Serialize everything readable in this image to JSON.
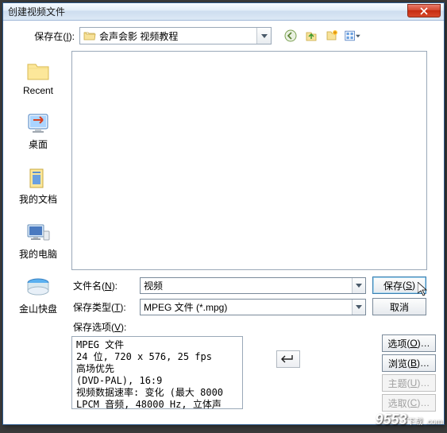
{
  "title": "创建视频文件",
  "save_in_label": "保存在",
  "save_in_key": "I",
  "location": "会声会影  视频教程",
  "sidebar": [
    {
      "label": "Recent"
    },
    {
      "label": "桌面"
    },
    {
      "label": "我的文档"
    },
    {
      "label": "我的电脑"
    },
    {
      "label": "金山快盘"
    }
  ],
  "filename_label": "文件名",
  "filename_key": "N",
  "filename_value": "视频",
  "filetype_label": "保存类型",
  "filetype_key": "T",
  "filetype_value": "MPEG 文件 (*.mpg)",
  "save_btn": "保存",
  "save_key": "S",
  "cancel_btn": "取消",
  "options_label": "保存选项",
  "options_key": "V",
  "info_lines": "MPEG 文件\n24 位, 720 x 576, 25 fps\n高场优先\n(DVD-PAL), 16:9\n视频数据速率: 变化 (最大  8000\nLPCM 音频, 48000 Hz, 立体声",
  "opt_btn": "选项",
  "opt_key": "O",
  "browse_btn": "浏览",
  "browse_key": "B",
  "subject_btn": "主题",
  "subject_key": "U",
  "select_btn": "选取",
  "select_key": "C",
  "watermark": "9553",
  "watermark_sub": "下载\n.com"
}
